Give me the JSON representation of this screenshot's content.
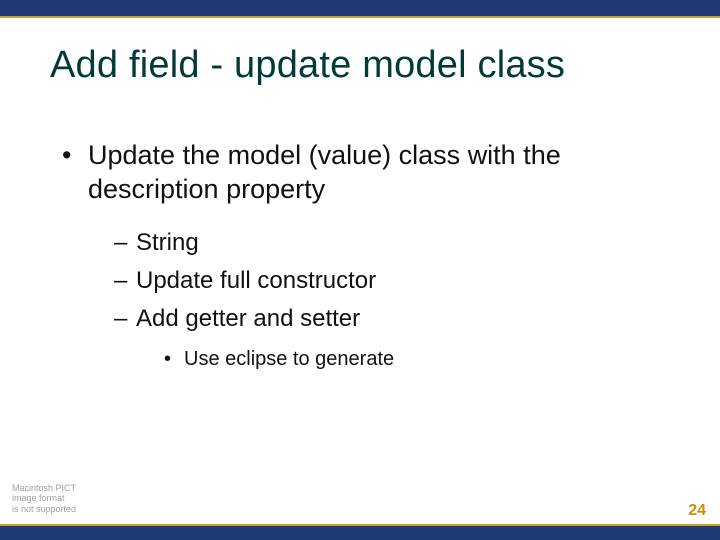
{
  "title": "Add field - update model class",
  "bullets": {
    "level1": [
      {
        "text": "Update the model (value) class with the description property",
        "children": [
          {
            "text": "String"
          },
          {
            "text": "Update full constructor"
          },
          {
            "text": "Add getter and setter",
            "children": [
              {
                "text": "Use eclipse to generate"
              }
            ]
          }
        ]
      }
    ]
  },
  "placeholder": {
    "line1": "Macintosh PICT",
    "line2": "image format",
    "line3": "is not supported"
  },
  "page_number": "24"
}
